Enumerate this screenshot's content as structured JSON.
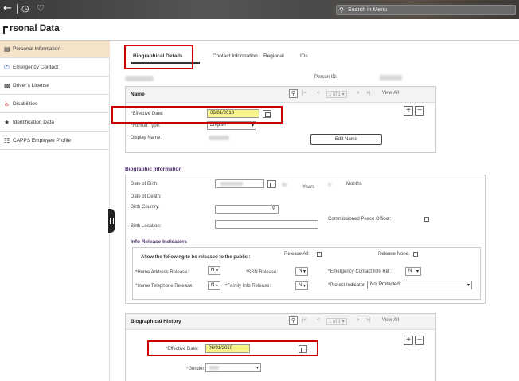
{
  "header": {
    "back_icon": "back-arrow-icon",
    "history_icon": "clock-icon",
    "favorite_icon": "heart-icon",
    "search_placeholder": "Search in Menu",
    "page_title": "rsonal Data"
  },
  "sidebar": {
    "items": [
      {
        "label": "Personal Information",
        "icon": "id-card-icon",
        "active": true
      },
      {
        "label": "Emergency Contact",
        "icon": "phone-icon"
      },
      {
        "label": "Driver's License",
        "icon": "license-icon"
      },
      {
        "label": "Disabilities",
        "icon": "accessibility-icon"
      },
      {
        "label": "Identification Data",
        "icon": "fingerprint-icon"
      },
      {
        "label": "CAPPS Employee Profile",
        "icon": "org-chart-icon"
      }
    ]
  },
  "tabs": [
    {
      "label": "Biographical Details",
      "active": true
    },
    {
      "label": "Contact Information"
    },
    {
      "label": "Regional"
    },
    {
      "label": "IDs"
    }
  ],
  "person_id_label": "Person ID:",
  "name_panel": {
    "title": "Name",
    "pager": "1 of 1",
    "view_all": "View All",
    "effective_date_label": "*Effective Date:",
    "effective_date": "06/01/2010",
    "format_type_label": "*Format Type:",
    "format_type": "English",
    "display_name_label": "Display Name:",
    "edit_name_button": "Edit Name"
  },
  "biographic_info": {
    "title": "Biographic Information",
    "dob_label": "Date of Birth:",
    "years_label": "Years",
    "months_label": "Months",
    "dod_label": "Date of Death:",
    "birth_country_label": "Birth Country:",
    "birth_location_label": "Birth Location:",
    "peace_officer_label": "Commissioned Peace Officer:"
  },
  "info_release": {
    "title": "Info Release Indicators",
    "allow_label": "Allow the following to be released to the public :",
    "release_all_label": "Release All:",
    "release_none_label": "Release None:",
    "home_address_label": "*Home Address Release:",
    "home_address_value": "N",
    "ssn_label": "*SSN Release:",
    "ssn_value": "N",
    "emergency_label": "*Emergency Contact Info Rel:",
    "emergency_value": "N",
    "home_phone_label": "*Home Telephone Release:",
    "home_phone_value": "N",
    "family_label": "*Family Info Release:",
    "family_value": "N",
    "protect_label": "*Protect Indicator",
    "protect_value": "Not Protected"
  },
  "bio_history": {
    "title": "Biographical History",
    "pager": "1 of 1",
    "view_all": "View All",
    "effective_date_label": "*Effective Date:",
    "effective_date": "06/01/2010",
    "gender_label": "*Gender:"
  },
  "colors": {
    "highlight_red": "#cc0000",
    "field_highlight": "#f8f48c",
    "sidebar_active": "#f5e3c9",
    "section_title": "#4a2d6b"
  }
}
